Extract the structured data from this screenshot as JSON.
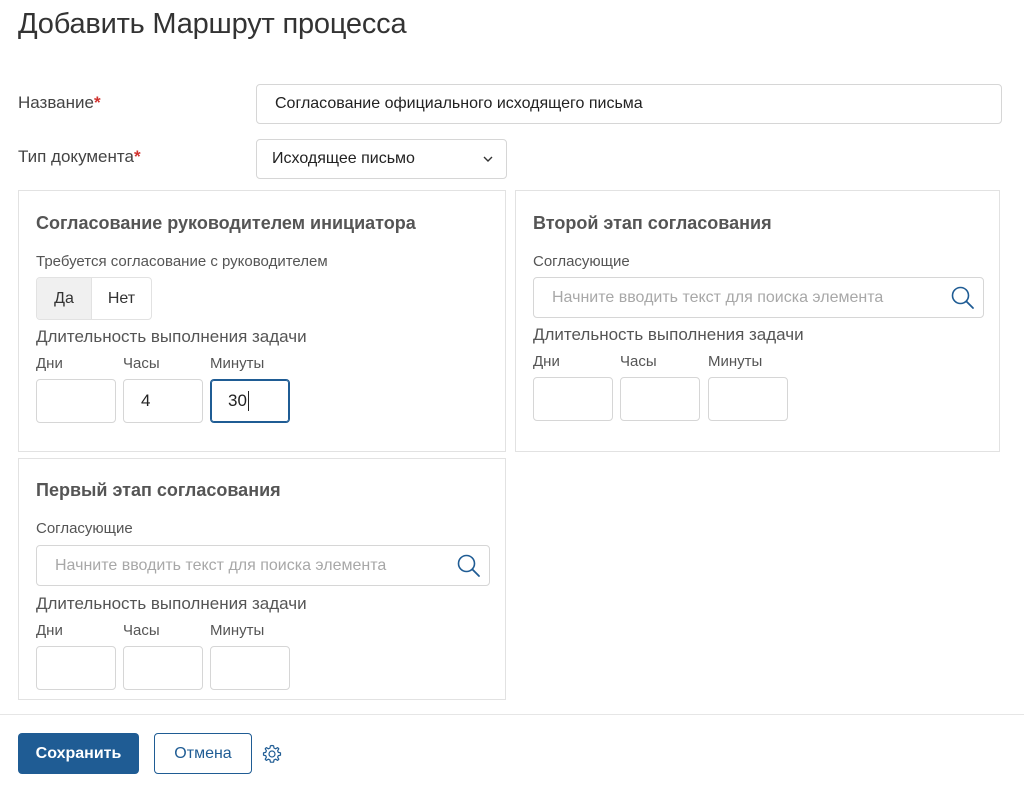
{
  "title": "Добавить Маршрут процесса",
  "form": {
    "name_label": "Название",
    "name_value": "Согласование официального исходящего письма",
    "doctype_label": "Тип документа",
    "doctype_value": "Исходящее письмо",
    "required_mark": "*"
  },
  "panel_manager": {
    "title": "Согласование руководителем инициатора",
    "question": "Требуется согласование с руководителем",
    "options": [
      "Да",
      "Нет"
    ],
    "selected": "Да",
    "duration_label": "Длительность выполнения задачи",
    "days_label": "Дни",
    "hours_label": "Часы",
    "minutes_label": "Минуты",
    "days_value": "",
    "hours_value": "4",
    "minutes_value": "30"
  },
  "panel_second": {
    "title": "Второй этап согласования",
    "approvers_label": "Согласующие",
    "search_placeholder": "Начните вводить текст для поиска элемента",
    "duration_label": "Длительность выполнения задачи",
    "days_label": "Дни",
    "hours_label": "Часы",
    "minutes_label": "Минуты"
  },
  "panel_first": {
    "title": "Первый этап согласования",
    "approvers_label": "Согласующие",
    "search_placeholder": "Начните вводить текст для поиска элемента",
    "duration_label": "Длительность выполнения задачи",
    "days_label": "Дни",
    "hours_label": "Часы",
    "minutes_label": "Минуты"
  },
  "footer": {
    "save_label": "Сохранить",
    "cancel_label": "Отмена"
  },
  "colors": {
    "primary": "#1f5c94",
    "required": "#d0312d",
    "border": "#d6d6d6"
  },
  "icons": {
    "select_chevron": "chevron-down-icon",
    "search": "search-icon",
    "settings": "gear-icon"
  }
}
